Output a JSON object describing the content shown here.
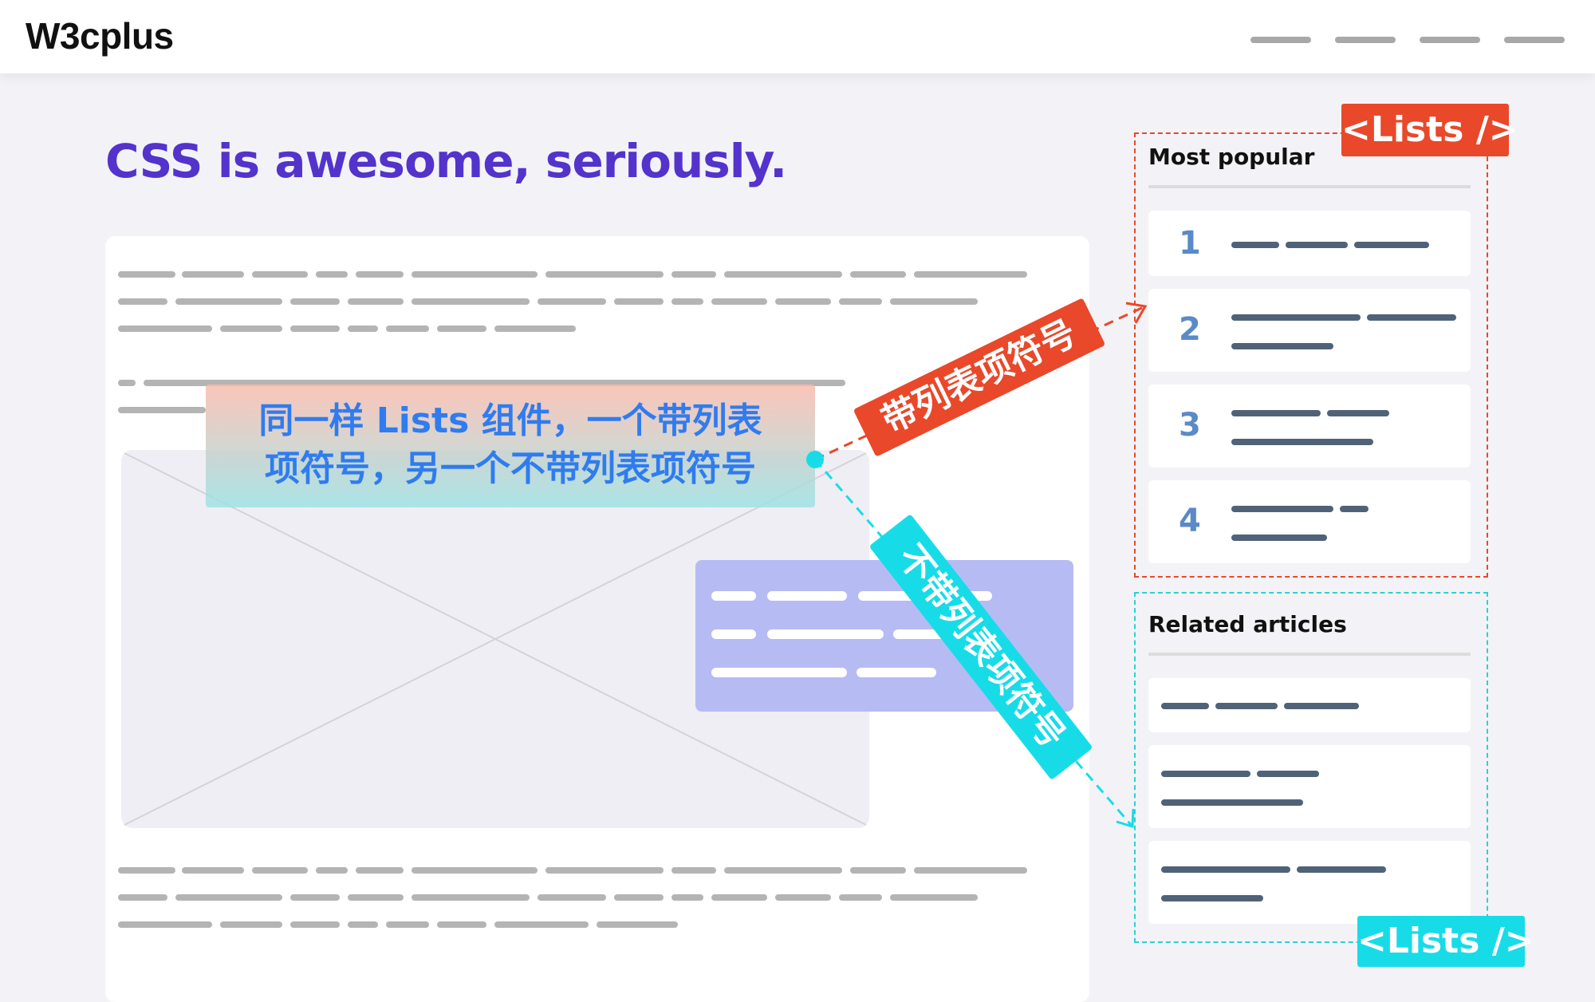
{
  "header": {
    "logo": "W3cplus"
  },
  "page": {
    "title": "CSS is awesome, seriously."
  },
  "annotation": {
    "line1": "同一样 Lists 组件，一个带列表",
    "line2": "项符号，另一个不带列表项符号"
  },
  "ribbons": {
    "with_bullets": "带列表项符号",
    "without_bullets": "不带列表项符号"
  },
  "most_popular": {
    "title": "Most popular",
    "tag": "<Lists />",
    "items": [
      "1",
      "2",
      "3",
      "4"
    ]
  },
  "related_articles": {
    "title": "Related articles",
    "tag": "<Lists />"
  },
  "colors": {
    "title": "#5333cc",
    "orange": "#e9482a",
    "cyan": "#17dce8",
    "number": "#5a8ac7",
    "callout": "#b7bbf3"
  }
}
